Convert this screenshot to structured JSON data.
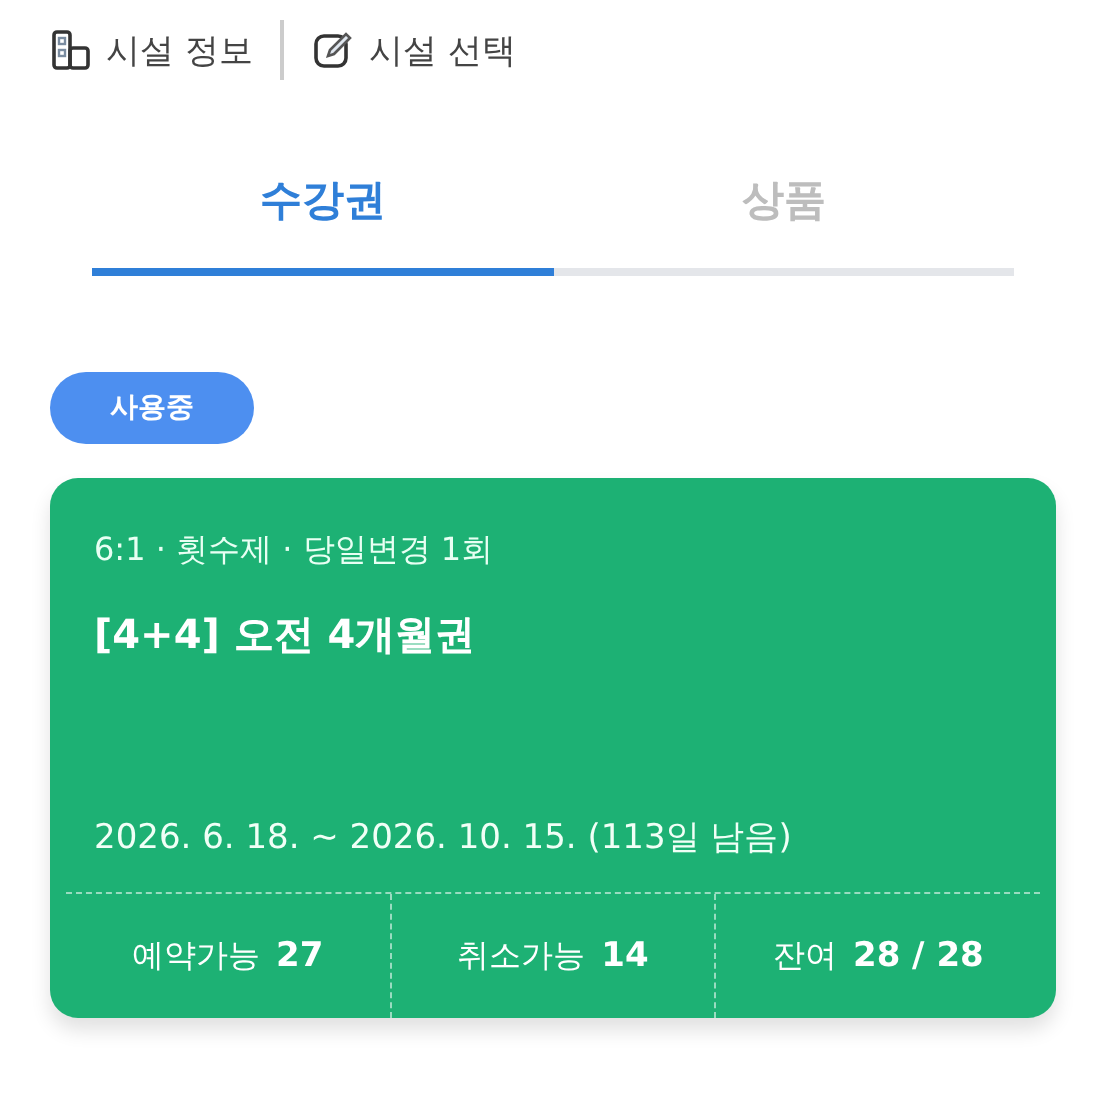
{
  "top_bar": {
    "items": [
      {
        "kind": "info",
        "label": "시설 정보"
      },
      {
        "kind": "edit",
        "label": "시설 선택"
      }
    ]
  },
  "tabs": [
    {
      "label": "수강권",
      "selected": true
    },
    {
      "label": "상품",
      "selected": false
    }
  ],
  "status_badge": "사용중",
  "pass_card": {
    "meta": "6:1 · 횟수제 · 당일변경 1회",
    "title": "[4+4] 오전 4개월권",
    "period": "2026. 6. 18. ~ 2026. 10. 15. (113일 남음)",
    "stats": [
      {
        "label": "예약가능",
        "value": "27"
      },
      {
        "label": "취소가능",
        "value": "14"
      },
      {
        "label": "잔여",
        "value": "28 / 28"
      }
    ]
  }
}
